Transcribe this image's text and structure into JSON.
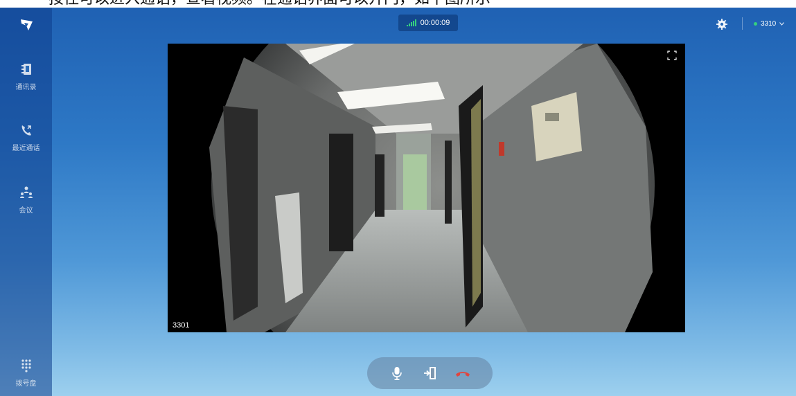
{
  "caption": {
    "text": "按住可以进入通话，查看视频。在通话界面可以开门，如下图所示"
  },
  "sidebar": {
    "items": [
      {
        "label": "通讯录",
        "icon": "contacts-icon"
      },
      {
        "label": "最近通话",
        "icon": "recent-calls-icon"
      },
      {
        "label": "会议",
        "icon": "conference-icon"
      }
    ],
    "dialpad": {
      "label": "拨号盘",
      "icon": "dialpad-icon"
    }
  },
  "header": {
    "call_timer": "00:00:09",
    "signal_icon": "signal-bars-icon",
    "account": "3310",
    "account_status_color": "#35d07f",
    "settings_icon": "gear-icon"
  },
  "video": {
    "caller": "3301",
    "expand_icon": "expand-icon"
  },
  "controls": {
    "mute_icon": "microphone-icon",
    "open_door_icon": "door-open-icon",
    "hangup_icon": "hangup-icon",
    "hangup_color": "#e0453f"
  }
}
